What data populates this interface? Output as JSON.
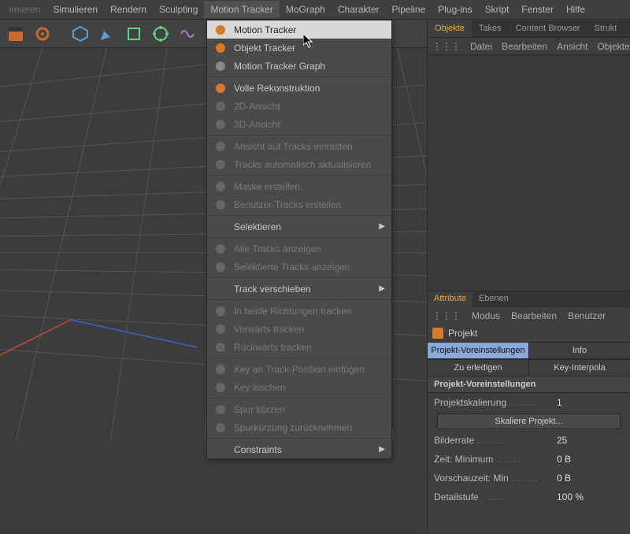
{
  "menubar": [
    "imieren",
    "Simulieren",
    "Rendern",
    "Sculpting",
    "Motion Tracker",
    "MoGraph",
    "Charakter",
    "Pipeline",
    "Plug-ins",
    "Skript",
    "Fenster",
    "Hilfe"
  ],
  "menu_open_index": 4,
  "dropdown": [
    {
      "label": "Motion Tracker",
      "highlight": true,
      "icon": "mt",
      "enabled": true
    },
    {
      "label": "Objekt Tracker",
      "icon": "ot",
      "enabled": true
    },
    {
      "label": "Motion Tracker Graph",
      "icon": "mg",
      "enabled": true
    },
    {
      "sep": true
    },
    {
      "label": "Volle Rekonstruktion",
      "icon": "vr",
      "enabled": true
    },
    {
      "label": "2D-Ansicht",
      "icon": "2d",
      "enabled": false
    },
    {
      "label": "3D-Ansicht",
      "icon": "3d",
      "enabled": false
    },
    {
      "sep": true
    },
    {
      "label": "Ansicht auf Tracks einrasten",
      "icon": "sn",
      "enabled": false
    },
    {
      "label": "Tracks automatisch aktualisieren",
      "icon": "au",
      "enabled": false
    },
    {
      "sep": true
    },
    {
      "label": "Maske erstellen",
      "icon": "mk",
      "enabled": false
    },
    {
      "label": "Benutzer-Tracks erstellen",
      "icon": "bt",
      "enabled": false
    },
    {
      "sep": true
    },
    {
      "label": "Selektieren",
      "submenu": true,
      "enabled": true
    },
    {
      "sep": true
    },
    {
      "label": "Alle Tracks anzeigen",
      "icon": "at",
      "enabled": false
    },
    {
      "label": "Selektierte Tracks anzeigen",
      "icon": "st",
      "enabled": false
    },
    {
      "sep": true
    },
    {
      "label": "Track verschieben",
      "submenu": true,
      "enabled": true
    },
    {
      "sep": true
    },
    {
      "label": "In beide Richtungen tracken",
      "icon": "tb",
      "enabled": false
    },
    {
      "label": "Vorwärts tracken",
      "icon": "tf",
      "enabled": false
    },
    {
      "label": "Rückwärts tracken",
      "icon": "tr",
      "enabled": false
    },
    {
      "sep": true
    },
    {
      "label": "Key an Track-Position einfügen",
      "icon": "ki",
      "enabled": false
    },
    {
      "label": "Key löschen",
      "icon": "kd",
      "enabled": false
    },
    {
      "sep": true
    },
    {
      "label": "Spur kürzen",
      "icon": "sk",
      "enabled": false
    },
    {
      "label": "Spurkürzung zurücknehmen",
      "icon": "sz",
      "enabled": false
    },
    {
      "sep": true
    },
    {
      "label": "Constraints",
      "submenu": true,
      "enabled": true
    }
  ],
  "right": {
    "tabs": [
      "Objekte",
      "Takes",
      "Content Browser",
      "Strukt"
    ],
    "active_tab": 0,
    "subtoolbar": [
      "Datei",
      "Bearbeiten",
      "Ansicht",
      "Objekte"
    ],
    "attr_tabs": [
      "Attribute",
      "Ebenen"
    ],
    "attr_active": 0,
    "attr_toolbar": [
      "Modus",
      "Bearbeiten",
      "Benutzer"
    ],
    "attr_head": "Projekt",
    "row1": [
      "Projekt-Voreinstellungen",
      "Info"
    ],
    "row1_sel": 0,
    "row2": [
      "Zu erledigen",
      "Key-Interpola"
    ],
    "section": "Projekt-Voreinstellungen",
    "props": [
      {
        "label": "Projektskalierung",
        "value": "1"
      },
      {
        "button": "Skaliere Projekt..."
      },
      {
        "label": "Bilderrate",
        "value": "25"
      },
      {
        "label": "Zeit: Minimum",
        "value": "0 B"
      },
      {
        "label": "Vorschauzeit: Min",
        "value": "0 B"
      },
      {
        "label": "Detailstufe",
        "value": "100 %"
      }
    ]
  }
}
